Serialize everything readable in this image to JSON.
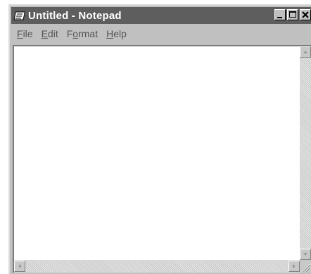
{
  "window": {
    "title": "Untitled - Notepad"
  },
  "menu": {
    "file": {
      "first": "F",
      "rest": "ile"
    },
    "edit": {
      "first": "E",
      "rest": "dit"
    },
    "format": {
      "first": "F",
      "mid": "o",
      "rest": "rmat"
    },
    "help": {
      "first": "H",
      "rest": "elp"
    }
  },
  "editor": {
    "value": ""
  },
  "icons": {
    "app": "notepad-icon",
    "minimize": "minimize-icon",
    "maximize": "maximize-icon",
    "close": "close-icon"
  },
  "colors": {
    "titlebar": "#5e5e5e",
    "chrome": "#c0c0c0",
    "editor_bg": "#ffffff"
  }
}
